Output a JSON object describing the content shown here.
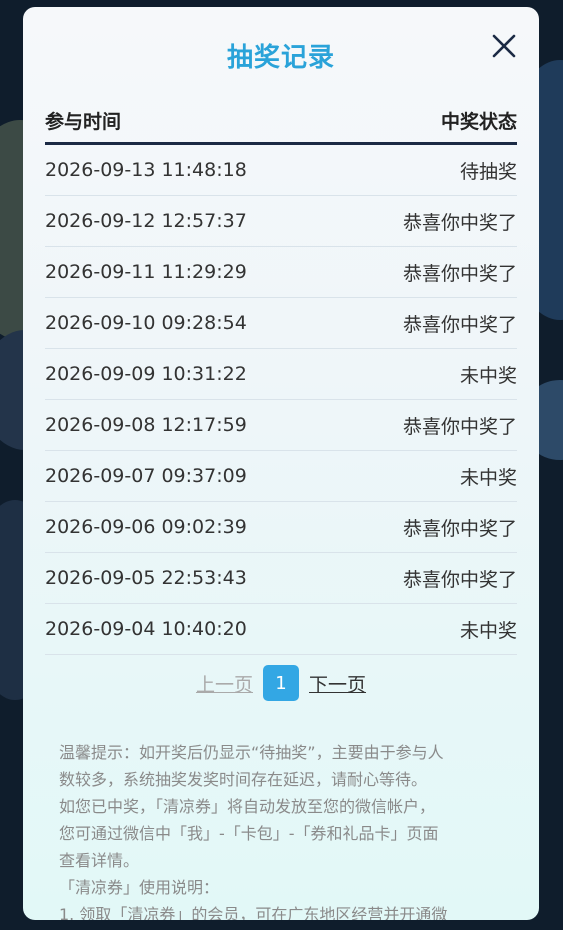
{
  "dialog": {
    "title": "抽奖记录",
    "close_icon": "close-icon"
  },
  "table": {
    "headers": {
      "time": "参与时间",
      "status": "中奖状态"
    },
    "rows": [
      {
        "time": "2026-09-13 11:48:18",
        "status": "待抽奖"
      },
      {
        "time": "2026-09-12 12:57:37",
        "status": "恭喜你中奖了"
      },
      {
        "time": "2026-09-11 11:29:29",
        "status": "恭喜你中奖了"
      },
      {
        "time": "2026-09-10 09:28:54",
        "status": "恭喜你中奖了"
      },
      {
        "time": "2026-09-09 10:31:22",
        "status": "未中奖"
      },
      {
        "time": "2026-09-08 12:17:59",
        "status": "恭喜你中奖了"
      },
      {
        "time": "2026-09-07 09:37:09",
        "status": "未中奖"
      },
      {
        "time": "2026-09-06 09:02:39",
        "status": "恭喜你中奖了"
      },
      {
        "time": "2026-09-05 22:53:43",
        "status": "恭喜你中奖了"
      },
      {
        "time": "2026-09-04 10:40:20",
        "status": "未中奖"
      }
    ]
  },
  "pagination": {
    "prev_label": "上一页",
    "current_page": "1",
    "next_label": "下一页"
  },
  "notes": {
    "lines": [
      "温馨提示：如开奖后仍显示“待抽奖”，主要由于参与人",
      "数较多，系统抽奖发奖时间存在延迟，请耐心等待。",
      "如您已中奖，「清凉券」将自动发放至您的微信帐户，",
      "您可通过微信中「我」-「卡包」-「券和礼品卡」页面",
      "查看详情。",
      "「清凉券」使用说明：",
      "1. 领取「清凉券」的会员，可在广东地区经营并开通微"
    ]
  },
  "colors": {
    "accent": "#2aa3d9",
    "page_button": "#33a7e4",
    "header_rule": "#1b2a44"
  }
}
